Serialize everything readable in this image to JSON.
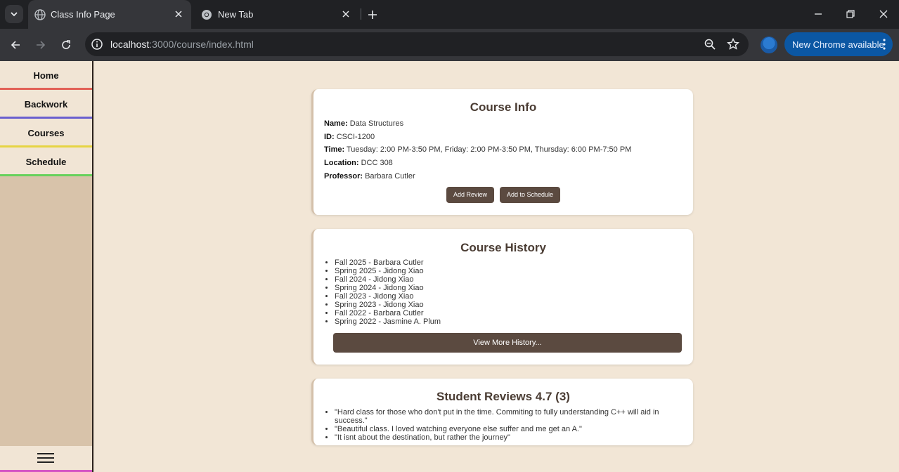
{
  "browser": {
    "tabs": [
      {
        "title": "Class Info Page",
        "active": true
      },
      {
        "title": "New Tab",
        "active": false
      }
    ],
    "url_host": "localhost",
    "url_path": ":3000/course/index.html",
    "update_label": "New Chrome available"
  },
  "sidebar": {
    "items": [
      {
        "label": "Home"
      },
      {
        "label": "Backwork"
      },
      {
        "label": "Courses"
      },
      {
        "label": "Schedule"
      }
    ]
  },
  "course_info": {
    "title": "Course Info",
    "name_label": "Name:",
    "name": "Data Structures",
    "id_label": "ID:",
    "id": "CSCI-1200",
    "time_label": "Time:",
    "time": "Tuesday: 2:00 PM-3:50 PM, Friday: 2:00 PM-3:50 PM, Thursday: 6:00 PM-7:50 PM",
    "location_label": "Location:",
    "location": "DCC 308",
    "professor_label": "Professor:",
    "professor": "Barbara Cutler",
    "add_review_label": "Add Review",
    "add_schedule_label": "Add to Schedule"
  },
  "course_history": {
    "title": "Course History",
    "entries": [
      "Fall 2025 - Barbara Cutler",
      "Spring 2025 - Jidong Xiao",
      "Fall 2024 - Jidong Xiao",
      "Spring 2024 - Jidong Xiao",
      "Fall 2023 - Jidong Xiao",
      "Spring 2023 - Jidong Xiao",
      "Fall 2022 - Barbara Cutler",
      "Spring 2022 - Jasmine A. Plum"
    ],
    "more_label": "View More History..."
  },
  "reviews": {
    "title": "Student Reviews 4.7 (3)",
    "entries": [
      "\"Hard class for those who don't put in the time. Commiting to fully understanding C++ will aid in success.\"",
      "\"Beautiful class. I loved watching everyone else suffer and me get an A.\"",
      "\"It isnt about the destination, but rather the journey\""
    ]
  }
}
